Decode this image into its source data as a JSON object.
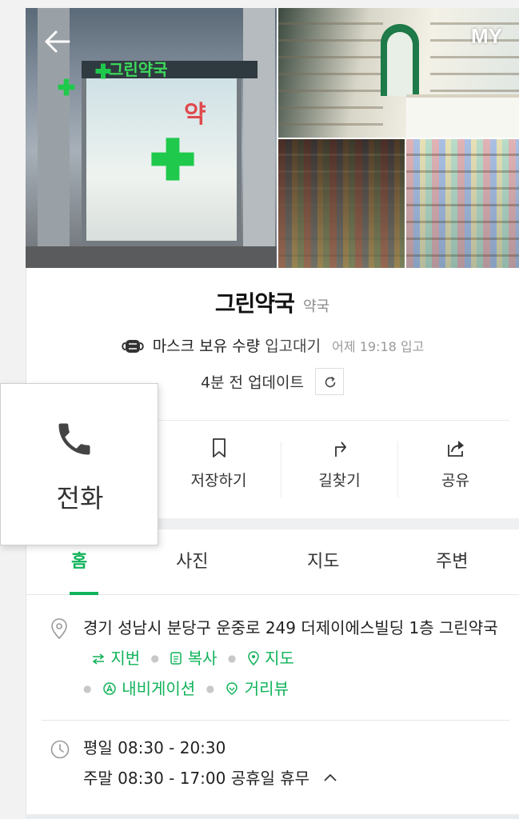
{
  "nav": {
    "my_label": "MY"
  },
  "photos": {
    "store_sign": "그린약국",
    "store_char": "약"
  },
  "place": {
    "name": "그린약국",
    "category": "약국"
  },
  "mask": {
    "label": "마스크 보유 수량",
    "status": "입고대기",
    "last_stock": "어제 19:18 입고",
    "updated": "4분 전 업데이트"
  },
  "actions": [
    {
      "label": "저장하기",
      "icon": "bookmark-icon"
    },
    {
      "label": "길찾기",
      "icon": "directions-icon"
    },
    {
      "label": "공유",
      "icon": "share-icon"
    }
  ],
  "call": {
    "label": "전화",
    "icon": "phone-icon"
  },
  "tabs": [
    {
      "label": "홈",
      "active": true
    },
    {
      "label": "사진",
      "active": false
    },
    {
      "label": "지도",
      "active": false
    },
    {
      "label": "주변",
      "active": false
    }
  ],
  "address": {
    "text": "경기 성남시 분당구 운중로 249 더제이에스빌딩 1층 그린약국",
    "links": [
      "지번",
      "복사",
      "지도",
      "내비게이션",
      "거리뷰"
    ]
  },
  "hours": {
    "weekday": "평일 08:30 - 20:30",
    "weekend": "주말 08:30 - 17:00 공휴일 휴무"
  },
  "colors": {
    "accent": "#10b35a",
    "text": "#222222",
    "muted": "#8a8a8a"
  }
}
